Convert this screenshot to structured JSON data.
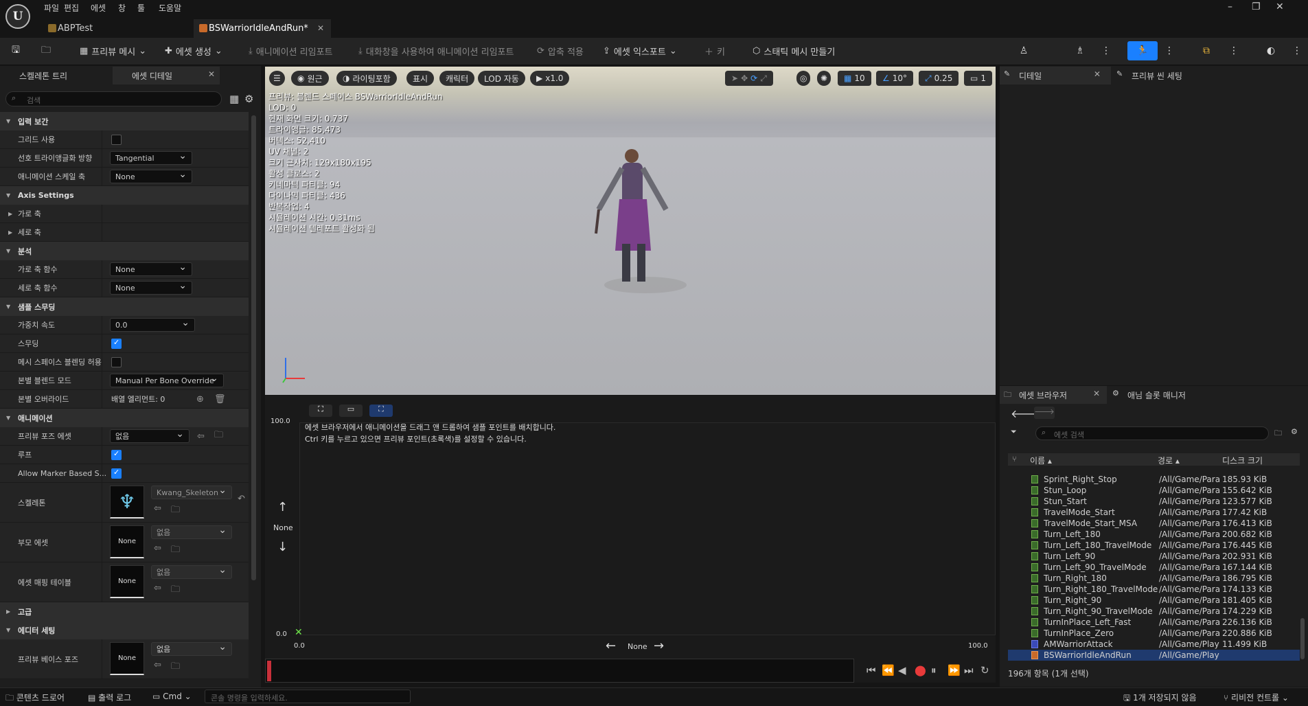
{
  "menu": [
    "파일",
    "편집",
    "에셋",
    "창",
    "툴",
    "도움말"
  ],
  "tabs": {
    "project": "ABPTest",
    "asset": "BSWarriorIdleAndRun*"
  },
  "toolbar": {
    "preview_mesh": "프리뷰 메시",
    "create_asset": "에셋 생성",
    "reimport": "애니메이션 리임포트",
    "reimport_dialog": "대화창을 사용하여 애니메이션 리임포트",
    "apply_compression": "압축 적용",
    "export_asset": "에셋 익스포트",
    "key": "키",
    "make_static_mesh": "스태틱 메시 만들기"
  },
  "left_panel": {
    "tab_skeleton": "스켈레톤 트리",
    "tab_asset_details": "에셋 디테일",
    "search_placeholder": "검색",
    "cat_input": "입력 보간",
    "grid": "그리드 사용",
    "triangulation": "선호 트라이앵글화 방향",
    "triangulation_value": "Tangential",
    "anim_scale_axis": "애니메이션 스케일 축",
    "anim_scale_value": "None",
    "axis_settings": "Axis Settings",
    "h_axis": "가로 축",
    "v_axis": "세로 축",
    "analysis": "분석",
    "h_func": "가로 축 함수",
    "h_func_value": "None",
    "v_func": "세로 축 함수",
    "v_func_value": "None",
    "sample_smoothing": "샘플 스무딩",
    "weight_speed": "가중치 속도",
    "weight_speed_value": "0.0",
    "smoothing": "스무딩",
    "mesh_blend": "메시 스페이스 블렌딩 허용",
    "bone_blend_mode": "본별 블렌드 모드",
    "bone_blend_mode_value": "Manual Per Bone Override",
    "bone_override": "본별 오버라이드",
    "bone_override_value": "배열 엘리먼트: 0",
    "animation": "애니메이션",
    "preview_pose": "프리뷰 포즈 에셋",
    "preview_pose_value": "없음",
    "loop": "루프",
    "allow_marker": "Allow Marker Based S...",
    "skeleton": "스켈레톤",
    "skeleton_value": "Kwang_Skeleton",
    "parent_asset": "부모 에셋",
    "parent_value": "없음",
    "asset_mapping": "에셋 매핑 테이블",
    "asset_mapping_value": "없음",
    "none_thumb": "None",
    "advanced": "고급",
    "editor_settings": "에디터 세팅",
    "preview_base_pose": "프리뷰 베이스 포즈",
    "preview_base_value": "없음"
  },
  "viewport": {
    "perspective": "원근",
    "lighting": "라이팅포함",
    "show": "표시",
    "character": "캐릭터",
    "lod": "LOD 자동",
    "speed": "x1.0",
    "grid_size": "10",
    "rot_size": "10°",
    "scale_size": "0.25",
    "cam_speed": "1",
    "info": [
      "프리뷰: 블렌드 스페이스 BSWarriorIdleAndRun",
      "LOD: 0",
      "현재 화면 크기: 0.737",
      "트라이앵글: 85,473",
      "버텍스: 52,410",
      "UV 채널: 2",
      "크기 근사치: 129x180x195",
      "활성 클로스: 2",
      "키네마틱 파티클: 94",
      "다이나믹 파티클: 436",
      "반복작업: 4",
      "시뮬레이션 시간: 0.31ms",
      "시뮬레이션 텔레포트 활성화 됨"
    ]
  },
  "blendspace": {
    "hint1": "에셋 브라우저에서 애니메이션을 드래그 앤 드롭하여 샘플 포인트를 배치합니다.",
    "hint2": "Ctrl 키를 누르고 있으면 프리뷰 포인트(초록색)를 설정할 수 있습니다.",
    "y_max": "100.0",
    "y_min": "0.0",
    "x_min": "0.0",
    "x_max": "100.0",
    "y_label": "None",
    "x_label": "None"
  },
  "right_panel": {
    "details": "디테일",
    "preview_scene": "프리뷰 씬 세팅"
  },
  "asset_browser": {
    "tab": "에셋 브라우저",
    "anim_slot": "애님 슬롯 매니저",
    "search_placeholder": "에셋 검색",
    "col_name": "이름",
    "col_path": "경로",
    "col_size": "디스크 크기",
    "footer": "196개 항목 (1개 선택)",
    "rows": [
      {
        "name": "Sprint_Right_Stop",
        "path": "/All/Game/Para",
        "size": "185.93 KiB"
      },
      {
        "name": "Stun_Loop",
        "path": "/All/Game/Para",
        "size": "155.642 KiB"
      },
      {
        "name": "Stun_Start",
        "path": "/All/Game/Para",
        "size": "123.577 KiB"
      },
      {
        "name": "TravelMode_Start",
        "path": "/All/Game/Para",
        "size": "177.42 KiB"
      },
      {
        "name": "TravelMode_Start_MSA",
        "path": "/All/Game/Para",
        "size": "176.413 KiB"
      },
      {
        "name": "Turn_Left_180",
        "path": "/All/Game/Para",
        "size": "200.682 KiB"
      },
      {
        "name": "Turn_Left_180_TravelMode",
        "path": "/All/Game/Para",
        "size": "176.445 KiB"
      },
      {
        "name": "Turn_Left_90",
        "path": "/All/Game/Para",
        "size": "202.931 KiB"
      },
      {
        "name": "Turn_Left_90_TravelMode",
        "path": "/All/Game/Para",
        "size": "167.144 KiB"
      },
      {
        "name": "Turn_Right_180",
        "path": "/All/Game/Para",
        "size": "186.795 KiB"
      },
      {
        "name": "Turn_Right_180_TravelMode",
        "path": "/All/Game/Para",
        "size": "174.133 KiB"
      },
      {
        "name": "Turn_Right_90",
        "path": "/All/Game/Para",
        "size": "181.405 KiB"
      },
      {
        "name": "Turn_Right_90_TravelMode",
        "path": "/All/Game/Para",
        "size": "174.229 KiB"
      },
      {
        "name": "TurnInPlace_Left_Fast",
        "path": "/All/Game/Para",
        "size": "226.136 KiB"
      },
      {
        "name": "TurnInPlace_Zero",
        "path": "/All/Game/Para",
        "size": "220.886 KiB"
      },
      {
        "name": "AMWarriorAttack",
        "path": "/All/Game/Play",
        "size": "11.499 KiB"
      },
      {
        "name": "BSWarriorIdleAndRun",
        "path": "/All/Game/Play",
        "size": ""
      }
    ]
  },
  "statusbar": {
    "content_drawer": "콘텐츠 드로어",
    "output_log": "출력 로그",
    "cmd": "Cmd",
    "console_placeholder": "콘솔 명령을 입력하세요.",
    "unsaved": "1개 저장되지 않음",
    "revision": "리비전 컨트롤"
  }
}
